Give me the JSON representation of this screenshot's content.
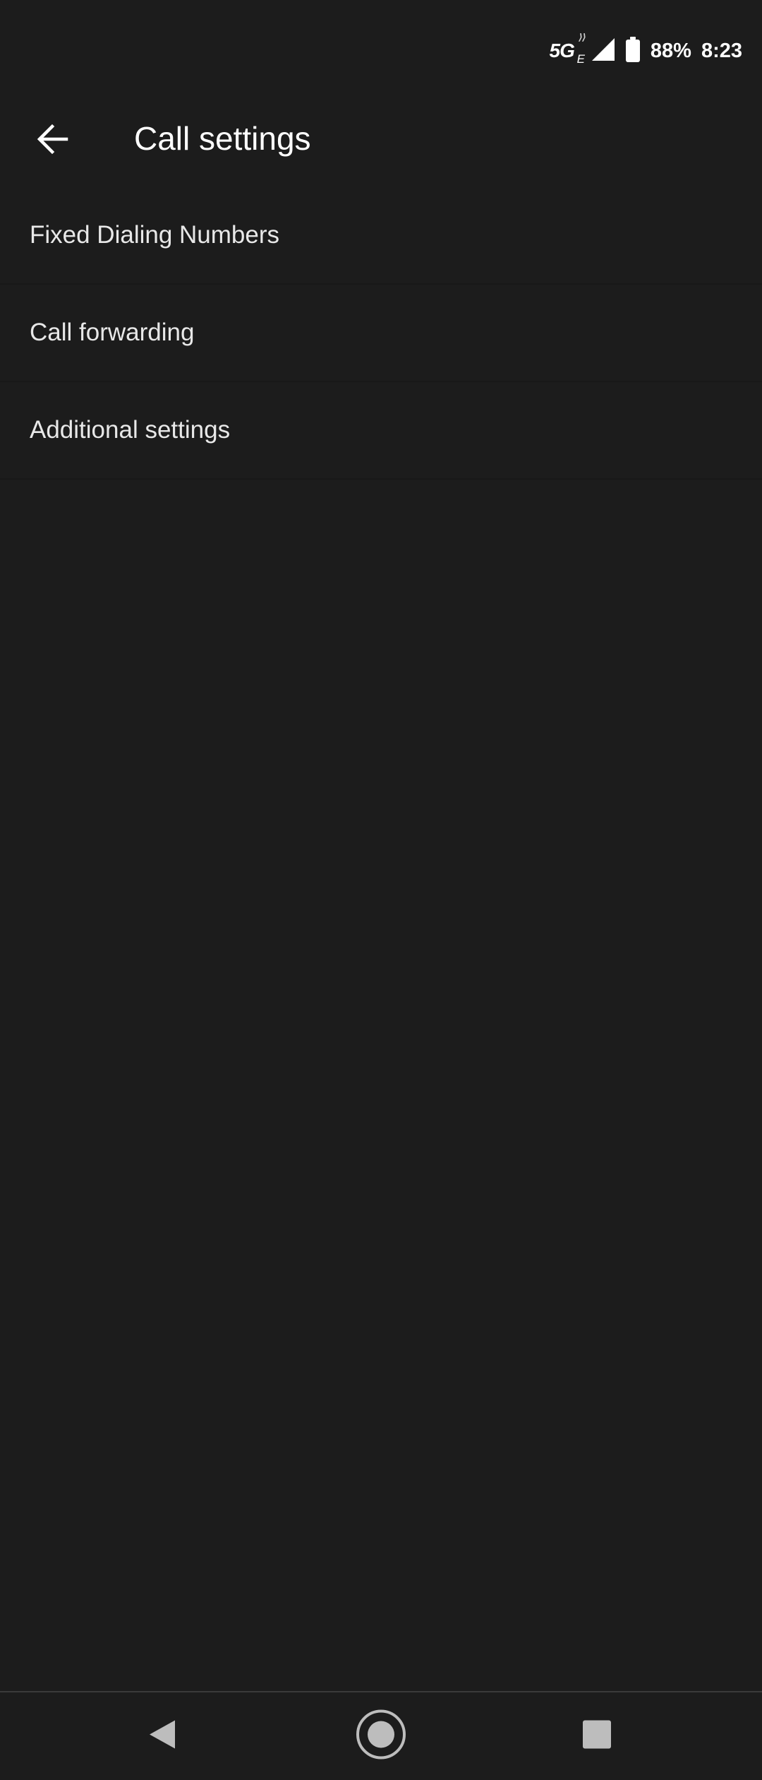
{
  "status_bar": {
    "network": "5G",
    "network_sub": "E",
    "battery_percent": "88%",
    "time": "8:23",
    "icons": [
      "network-5ge-icon",
      "signal-icon",
      "battery-icon"
    ]
  },
  "app_bar": {
    "back_icon": "arrow-back-icon",
    "title": "Call settings"
  },
  "settings": {
    "items": [
      {
        "label": "Fixed Dialing Numbers"
      },
      {
        "label": "Call forwarding"
      },
      {
        "label": "Additional settings"
      }
    ]
  },
  "nav_bar": {
    "buttons": [
      "back-triangle-icon",
      "home-circle-icon",
      "recents-square-icon"
    ]
  },
  "colors": {
    "background": "#1c1c1c",
    "text_primary": "#ffffff",
    "text_secondary": "#e8e8e8",
    "divider": "#181818"
  }
}
